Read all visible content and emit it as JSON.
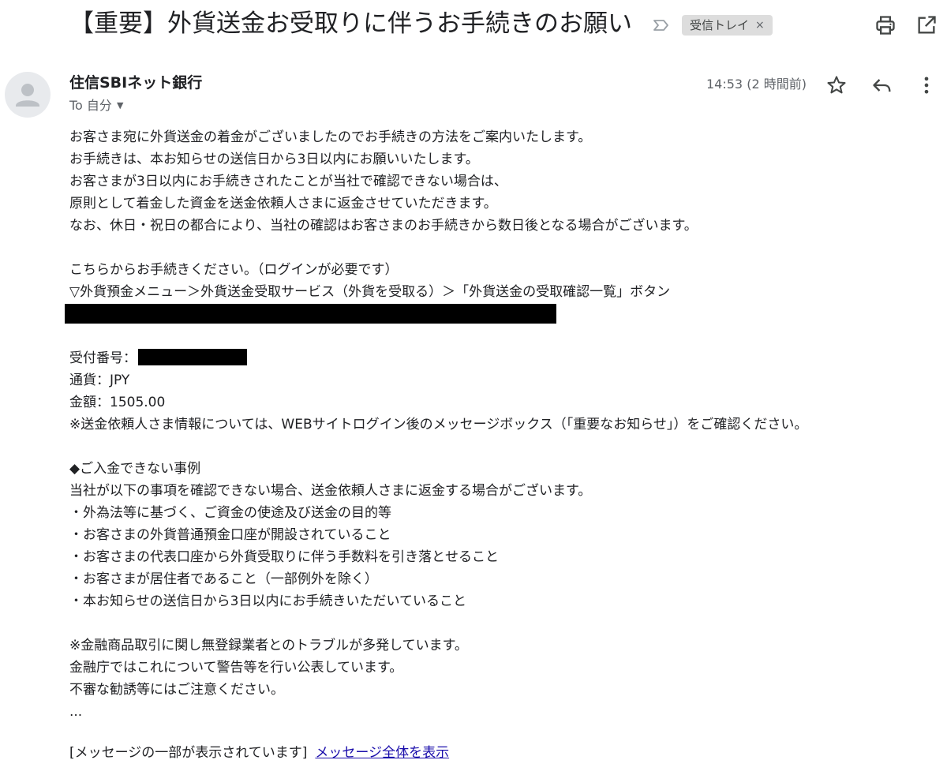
{
  "email": {
    "subject": "【重要】外貨送金お受取りに伴うお手続きのお願い",
    "label": "受信トレイ",
    "label_remove": "×",
    "sender": "住信SBIネット銀行",
    "to_label": "To 自分",
    "timestamp": "14:53 (2 時間前)",
    "icons": {
      "importance": "importance-marker-icon",
      "print": "print-icon",
      "popout": "open-in-new-window-icon",
      "star": "star-icon",
      "reply": "reply-icon",
      "more": "more-vertical-icon",
      "avatar": "default-avatar-icon"
    },
    "body_lines": {
      "l1": "お客さま宛に外貨送金の着金がございましたのでお手続きの方法をご案内いたします。",
      "l2": "お手続きは、本お知らせの送信日から3日以内にお願いいたします。",
      "l3": "お客さまが3日以内にお手続きされたことが当社で確認できない場合は、",
      "l4": "原則として着金した資金を送金依頼人さまに返金させていただきます。",
      "l5": "なお、休日・祝日の都合により、当社の確認はお客さまのお手続きから数日後となる場合がございます。",
      "l6": "こちらからお手続きください。（ログインが必要です）",
      "l7": "▽外貨預金メニュー＞外貨送金受取サービス（外貨を受取る）＞「外貨送金の受取確認一覧」ボタン",
      "receipt_label": "受付番号：",
      "currency": "通貨：JPY",
      "amount": "金額：1505.00",
      "note1": "※送金依頼人さま情報については、WEBサイトログイン後のメッセージボックス（「重要なお知らせ」）をご確認ください。",
      "heading": "◆ご入金できない事例",
      "l8": "当社が以下の事項を確認できない場合、送金依頼人さまに返金する場合がございます。",
      "b1": "・外為法等に基づく、ご資金の使途及び送金の目的等",
      "b2": "・お客さまの外貨普通預金口座が開設されていること",
      "b3": "・お客さまの代表口座から外貨受取りに伴う手数料を引き落とせること",
      "b4": "・お客さまが居住者であること（一部例外を除く）",
      "b5": "・本お知らせの送信日から3日以内にお手続きいただいていること",
      "note2": "※金融商品取引に関し無登録業者とのトラブルが多発しています。",
      "l9": "金融庁ではこれについて警告等を行い公表しています。",
      "l10": "不審な勧誘等にはご注意ください。",
      "ellipsis": "..."
    },
    "clipped_notice": "[メッセージの一部が表示されています]",
    "view_full_link": "メッセージ全体を表示"
  }
}
